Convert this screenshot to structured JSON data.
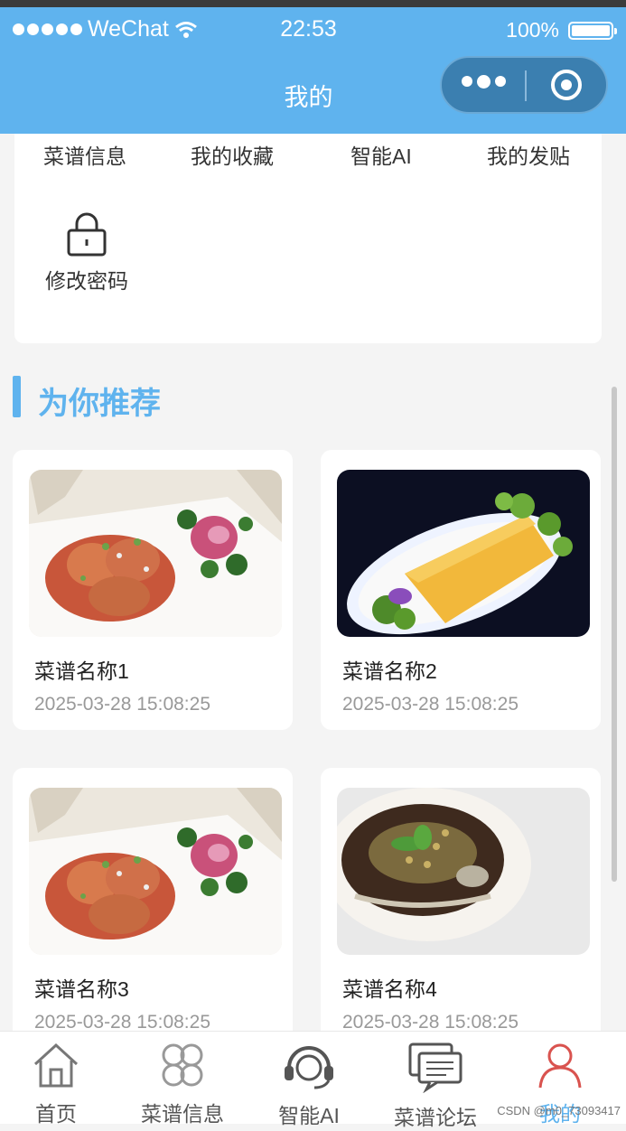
{
  "status_bar": {
    "carrier": "WeChat",
    "time": "22:53",
    "battery": "100%"
  },
  "nav": {
    "title": "我的"
  },
  "menu": {
    "items": [
      {
        "label": "菜谱信息",
        "icon": "none"
      },
      {
        "label": "我的收藏",
        "icon": "none"
      },
      {
        "label": "智能AI",
        "icon": "none"
      },
      {
        "label": "我的发贴",
        "icon": "none"
      },
      {
        "label": "修改密码",
        "icon": "lock-icon"
      }
    ]
  },
  "recommend": {
    "title": "为你推荐",
    "items": [
      {
        "name": "菜谱名称1",
        "date": "2025-03-28 15:08:25",
        "image": "dish-photo-plate"
      },
      {
        "name": "菜谱名称2",
        "date": "2025-03-28 15:08:25",
        "image": "dish-photo-yellow-cake"
      },
      {
        "name": "菜谱名称3",
        "date": "2025-03-28 15:08:25",
        "image": "dish-photo-plate"
      },
      {
        "name": "菜谱名称4",
        "date": "2025-03-28 15:08:25",
        "image": "dish-photo-bowl"
      }
    ]
  },
  "tabbar": {
    "items": [
      {
        "label": "首页",
        "icon": "home-icon",
        "active": false
      },
      {
        "label": "菜谱信息",
        "icon": "clover-icon",
        "active": false
      },
      {
        "label": "智能AI",
        "icon": "headset-icon",
        "active": false
      },
      {
        "label": "菜谱论坛",
        "icon": "chat-icon",
        "active": false
      },
      {
        "label": "我的",
        "icon": "user-icon",
        "active": true
      }
    ]
  },
  "watermark": "CSDN @m0_73093417",
  "colors": {
    "accent": "#5fb3ee",
    "user_icon": "#d9534f"
  }
}
